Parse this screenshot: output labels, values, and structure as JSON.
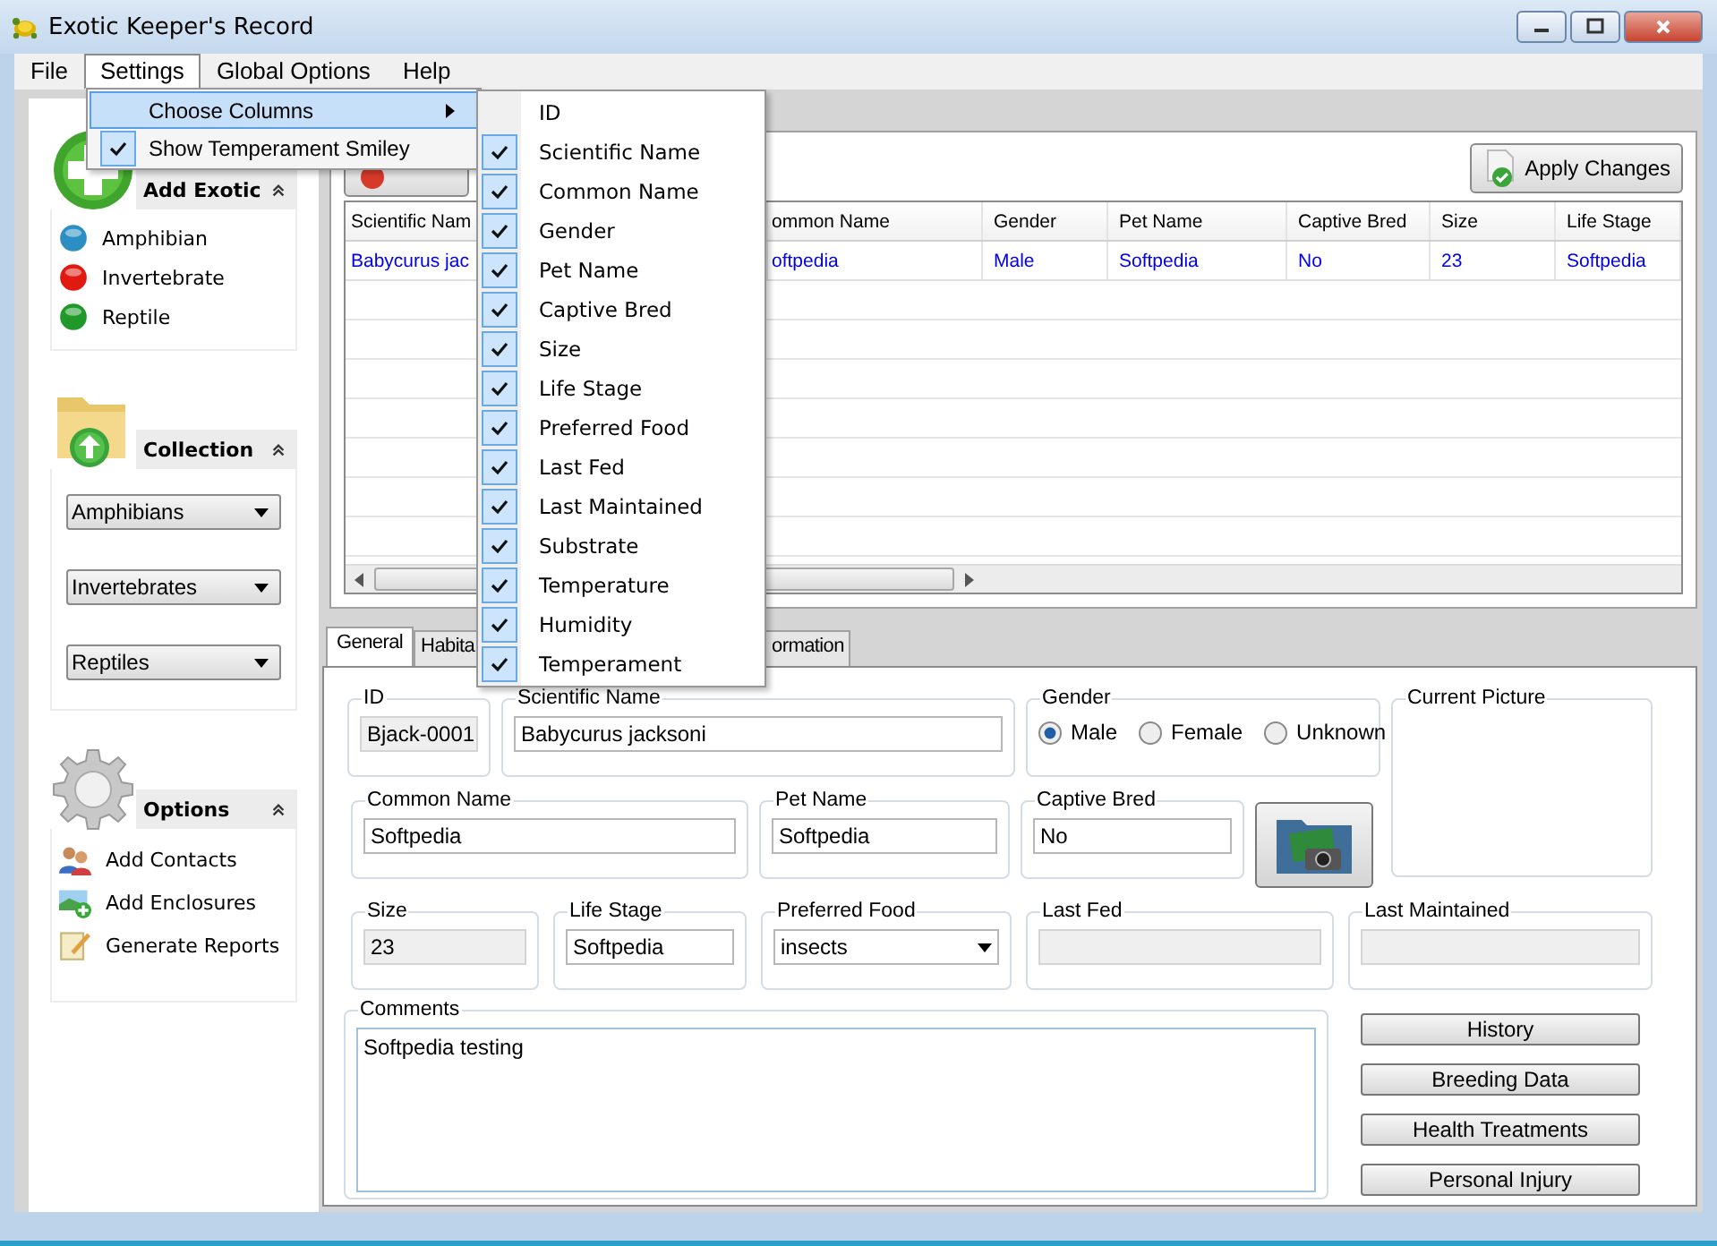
{
  "window": {
    "title": "Exotic Keeper's Record"
  },
  "menu_bar": [
    {
      "label": "File",
      "selected": false
    },
    {
      "label": "Settings",
      "selected": true
    },
    {
      "label": "Global Options",
      "selected": false
    },
    {
      "label": "Help",
      "selected": false
    }
  ],
  "settings_menu": [
    {
      "label": "Choose Columns",
      "selected": true,
      "has_submenu": true,
      "checked": false
    },
    {
      "label": "Show Temperament Smiley",
      "selected": false,
      "has_submenu": false,
      "checked": true
    }
  ],
  "columns_menu": [
    {
      "label": "ID",
      "checked": false
    },
    {
      "label": "Scientific Name",
      "checked": true
    },
    {
      "label": "Common Name",
      "checked": true
    },
    {
      "label": "Gender",
      "checked": true
    },
    {
      "label": "Pet Name",
      "checked": true
    },
    {
      "label": "Captive Bred",
      "checked": true
    },
    {
      "label": "Size",
      "checked": true
    },
    {
      "label": "Life Stage",
      "checked": true
    },
    {
      "label": "Preferred Food",
      "checked": true
    },
    {
      "label": "Last Fed",
      "checked": true
    },
    {
      "label": "Last Maintained",
      "checked": true
    },
    {
      "label": "Substrate",
      "checked": true
    },
    {
      "label": "Temperature",
      "checked": true
    },
    {
      "label": "Humidity",
      "checked": true
    },
    {
      "label": "Temperament",
      "checked": true
    }
  ],
  "sidebar": {
    "add_exotic": {
      "title": "Add Exotic",
      "items": [
        {
          "label": "Amphibian",
          "color": "#2b8fc4"
        },
        {
          "label": "Invertebrate",
          "color": "#e01a10"
        },
        {
          "label": "Reptile",
          "color": "#1f9a2a"
        }
      ]
    },
    "collection": {
      "title": "Collection",
      "dropdowns": [
        "Amphibians",
        "Invertebrates",
        "Reptiles"
      ]
    },
    "options": {
      "title": "Options",
      "items": [
        {
          "label": "Add Contacts",
          "kind": "contacts"
        },
        {
          "label": "Add Enclosures",
          "kind": "enclosure"
        },
        {
          "label": "Generate Reports",
          "kind": "report"
        }
      ]
    }
  },
  "toolbar": {
    "apply_button": "Apply Changes"
  },
  "table": {
    "columns": [
      "Scientific Nam",
      "ommon Name",
      "Gender",
      "Pet Name",
      "Captive Bred",
      "Size",
      "Life Stage"
    ],
    "rows": [
      [
        "Babycurus jac",
        "oftpedia",
        "Male",
        "Softpedia",
        "No",
        "23",
        "Softpedia"
      ]
    ]
  },
  "tabs": [
    {
      "label": "General",
      "selected": true
    },
    {
      "label": "Habita",
      "selected": false
    },
    {
      "label": "ormation",
      "selected": false
    }
  ],
  "form": {
    "id": {
      "label": "ID",
      "value": "Bjack-0001",
      "readonly": true
    },
    "scientific_name": {
      "label": "Scientific Name",
      "value": "Babycurus jacksoni",
      "readonly": false
    },
    "gender": {
      "label": "Gender",
      "options": [
        {
          "label": "Male",
          "selected": true
        },
        {
          "label": "Female",
          "selected": false
        },
        {
          "label": "Unknown",
          "selected": false
        }
      ]
    },
    "current_picture": {
      "label": "Current Picture"
    },
    "common_name": {
      "label": "Common Name",
      "value": "Softpedia",
      "readonly": false
    },
    "pet_name": {
      "label": "Pet Name",
      "value": "Softpedia",
      "readonly": false
    },
    "captive_bred": {
      "label": "Captive Bred",
      "value": "No",
      "readonly": false
    },
    "size": {
      "label": "Size",
      "value": "23",
      "readonly": true
    },
    "life_stage": {
      "label": "Life Stage",
      "value": "Softpedia",
      "readonly": false
    },
    "preferred_food": {
      "label": "Preferred Food",
      "value": "insects"
    },
    "last_fed": {
      "label": "Last Fed",
      "readonly": true
    },
    "last_maintained": {
      "label": "Last Maintained",
      "readonly": true
    },
    "comments": {
      "label": "Comments",
      "value": "Softpedia testing"
    }
  },
  "side_buttons": [
    "History",
    "Breeding Data",
    "Health Treatments",
    "Personal Injury"
  ]
}
